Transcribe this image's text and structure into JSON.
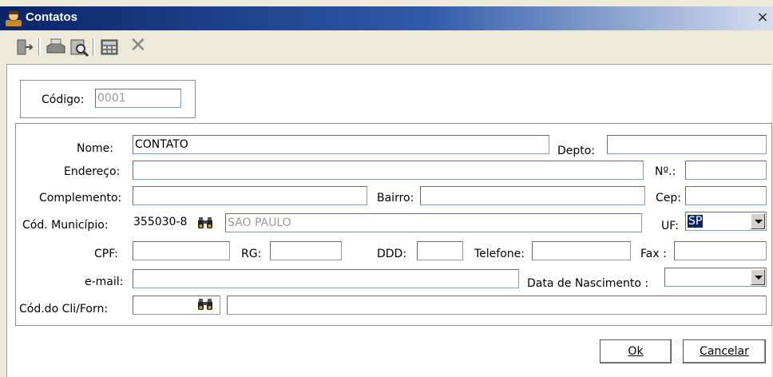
{
  "window": {
    "title": "Contatos",
    "close_glyph": "×"
  },
  "toolbar": {
    "icons": [
      "exit-icon",
      "print-icon",
      "preview-icon",
      "calculator-icon",
      "delete-icon"
    ],
    "delete_glyph": "✕"
  },
  "codigo": {
    "label": "Código:",
    "value": "0001"
  },
  "form": {
    "nome": {
      "label": "Nome:",
      "value": "CONTATO"
    },
    "depto": {
      "label": "Depto:",
      "value": ""
    },
    "endereco": {
      "label": "Endereço:",
      "value": ""
    },
    "numero": {
      "label": "Nº.:",
      "value": ""
    },
    "complemento": {
      "label": "Complemento:",
      "value": ""
    },
    "bairro": {
      "label": "Bairro:",
      "value": ""
    },
    "cep": {
      "label": "Cep:",
      "value": ""
    },
    "municipio": {
      "label": "Cód. Município:",
      "code": "355030-8",
      "name": "SAO PAULO"
    },
    "uf": {
      "label": "UF:",
      "value": "SP"
    },
    "cpf": {
      "label": "CPF:",
      "value": ""
    },
    "rg": {
      "label": "RG:",
      "value": ""
    },
    "ddd": {
      "label": "DDD:",
      "value": ""
    },
    "telefone": {
      "label": "Telefone:",
      "value": ""
    },
    "fax": {
      "label": "Fax :",
      "value": ""
    },
    "email": {
      "label": "e-mail:",
      "value": ""
    },
    "nascimento": {
      "label": "Data de Nascimento :",
      "value": ""
    },
    "cli_forn": {
      "label": "Cód.do Cli/Forn:",
      "code": "",
      "name": ""
    }
  },
  "buttons": {
    "ok": "Ok",
    "cancelar": "Cancelar"
  }
}
